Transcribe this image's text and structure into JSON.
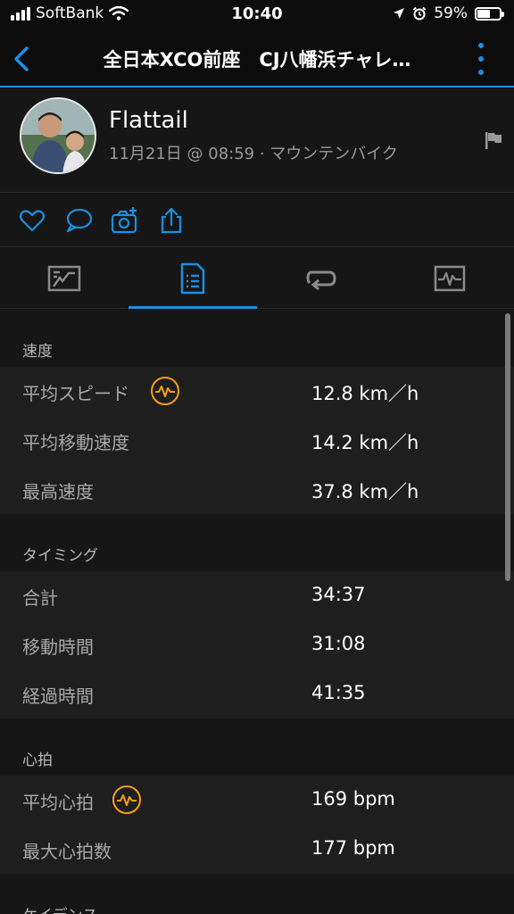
{
  "status_bar": {
    "carrier": "SoftBank",
    "time": "10:40",
    "battery_percent": "59%",
    "battery_level": 0.59
  },
  "nav": {
    "title": "全日本XCO前座　CJ八幡浜チャレ…"
  },
  "profile": {
    "name": "Flattail",
    "meta": "11月21日 @ 08:59 · マウンテンバイク"
  },
  "tabs": [
    {
      "icon": "map-chart-icon",
      "active": false
    },
    {
      "icon": "stats-document-icon",
      "active": true
    },
    {
      "icon": "laps-loop-icon",
      "active": false
    },
    {
      "icon": "graph-monitor-icon",
      "active": false
    }
  ],
  "sections": {
    "speed": {
      "title": "速度",
      "rows": [
        {
          "label": "平均スピード",
          "value": "12.8 km／h"
        },
        {
          "label": "平均移動速度",
          "value": "14.2 km／h"
        },
        {
          "label": "最高速度",
          "value": "37.8 km／h"
        }
      ]
    },
    "timing": {
      "title": "タイミング",
      "rows": [
        {
          "label": "合計",
          "value": "34:37"
        },
        {
          "label": "移動時間",
          "value": "31:08"
        },
        {
          "label": "経過時間",
          "value": "41:35"
        }
      ]
    },
    "heart_rate": {
      "title": "心拍",
      "rows": [
        {
          "label": "平均心拍",
          "value": "169 bpm"
        },
        {
          "label": "最大心拍数",
          "value": "177 bpm"
        }
      ]
    },
    "cadence": {
      "title": "ケイデンス"
    }
  },
  "colors": {
    "accent": "#1c8fe0",
    "badge": "#f5a00f",
    "background": "#111111"
  }
}
